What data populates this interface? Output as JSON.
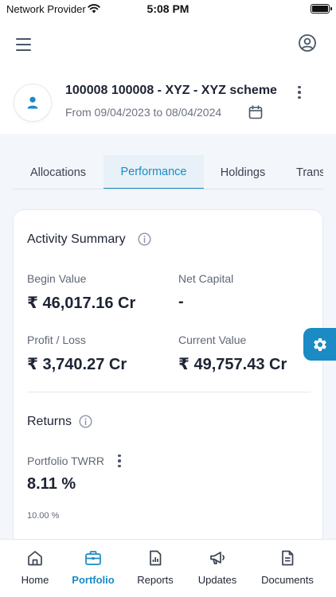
{
  "status_bar": {
    "carrier": "Network Provider",
    "time": "5:08 PM"
  },
  "scheme": {
    "name": "100008 100008 - XYZ - XYZ scheme",
    "date_range": "From 09/04/2023 to 08/04/2024"
  },
  "tabs": [
    {
      "label": "Allocations",
      "active": false
    },
    {
      "label": "Performance",
      "active": true
    },
    {
      "label": "Holdings",
      "active": false
    },
    {
      "label": "Transactions",
      "active": false
    }
  ],
  "activity_summary": {
    "title": "Activity Summary",
    "begin_value_label": "Begin Value",
    "begin_value": "₹ 46,017.16 Cr",
    "net_capital_label": "Net Capital",
    "net_capital": "-",
    "profit_loss_label": "Profit / Loss",
    "profit_loss": "₹ 3,740.27 Cr",
    "current_value_label": "Current Value",
    "current_value": "₹ 49,757.43 Cr"
  },
  "returns": {
    "title": "Returns",
    "twrr_label": "Portfolio TWRR",
    "twrr_value": "8.11 %",
    "axis_top_label": "10.00 %"
  },
  "bottom_nav": [
    {
      "label": "Home",
      "icon": "home-icon",
      "active": false
    },
    {
      "label": "Portfolio",
      "icon": "briefcase-icon",
      "active": true
    },
    {
      "label": "Reports",
      "icon": "report-icon",
      "active": false
    },
    {
      "label": "Updates",
      "icon": "megaphone-icon",
      "active": false
    },
    {
      "label": "Documents",
      "icon": "document-icon",
      "active": false
    }
  ],
  "colors": {
    "accent": "#1a8bc4",
    "background": "#f3f6fa",
    "text": "#1d2433",
    "muted": "#5f6776"
  }
}
